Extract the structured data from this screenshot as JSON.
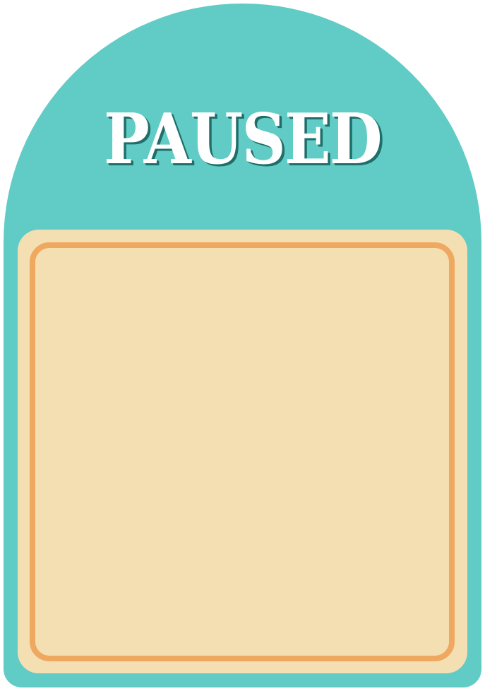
{
  "pause_menu": {
    "title": "PAUSED"
  },
  "colors": {
    "panel": "#60ccc5",
    "title_text": "#ffffff",
    "title_shadow": "#1f6e6b",
    "card_fill": "#f4dfb3",
    "card_border": "#eea860"
  }
}
